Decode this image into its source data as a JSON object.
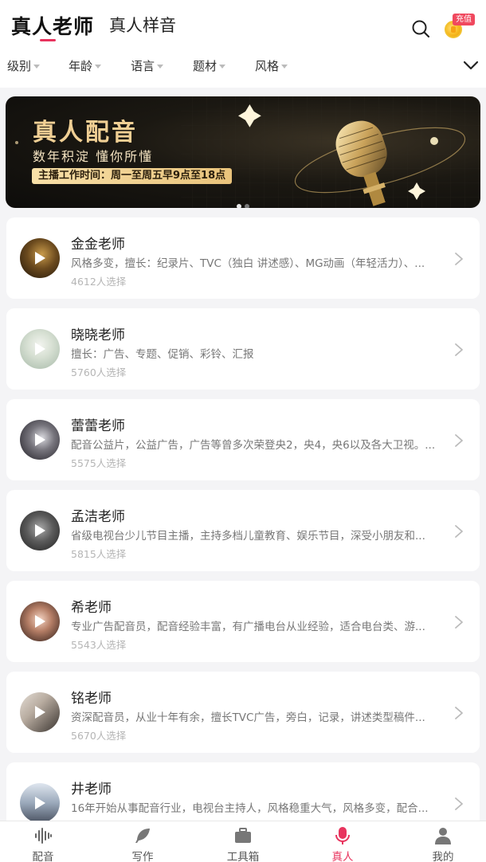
{
  "header": {
    "tabs": [
      {
        "label": "真人老师",
        "active": true
      },
      {
        "label": "真人样音",
        "active": false
      }
    ],
    "recharge_badge": "充值",
    "search_icon": "search-icon",
    "coin_icon": "coin-icon"
  },
  "filters": [
    {
      "label": "级别"
    },
    {
      "label": "年龄"
    },
    {
      "label": "语言"
    },
    {
      "label": "题材"
    },
    {
      "label": "风格"
    }
  ],
  "banner": {
    "title": "真人配音",
    "subtitle": "数年积淀 懂你所懂",
    "schedule": "主播工作时间：周一至周五早9点至18点",
    "page_count": 2,
    "current_page": 1
  },
  "teachers": [
    {
      "name": "金金老师",
      "desc": "风格多变，擅长：纪录片、TVC（独白 讲述感）、MG动画（年轻活力）、...",
      "count": "4612人选择"
    },
    {
      "name": "晓晓老师",
      "desc": "擅长：广告、专题、促销、彩铃、汇报",
      "count": "5760人选择"
    },
    {
      "name": "蕾蕾老师",
      "desc": "配音公益片，公益广告，广告等曾多次荣登央2，央4，央6以及各大卫视。...",
      "count": "5575人选择"
    },
    {
      "name": "孟洁老师",
      "desc": "省级电视台少儿节目主播，主持多档儿童教育、娱乐节目，深受小朋友和...",
      "count": "5815人选择"
    },
    {
      "name": "希老师",
      "desc": "专业广告配音员，配音经验丰富，有广播电台从业经验，适合电台类、游...",
      "count": "5543人选择"
    },
    {
      "name": "铭老师",
      "desc": "资深配音员，从业十年有余，擅长TVC广告，旁白，记录，讲述类型稿件...",
      "count": "5670人选择"
    },
    {
      "name": "井老师",
      "desc": "16年开始从事配音行业，电视台主持人，风格稳重大气，风格多变，配合...",
      "count": ""
    }
  ],
  "bottom_nav": [
    {
      "label": "配音",
      "icon": "waveform-icon",
      "active": false
    },
    {
      "label": "写作",
      "icon": "feather-icon",
      "active": false
    },
    {
      "label": "工具箱",
      "icon": "toolbox-icon",
      "active": false
    },
    {
      "label": "真人",
      "icon": "microphone-icon",
      "active": true
    },
    {
      "label": "我的",
      "icon": "person-icon",
      "active": false
    }
  ],
  "colors": {
    "accent": "#e8345e",
    "gold": "#f0cf94",
    "background": "#f4f4f6"
  }
}
